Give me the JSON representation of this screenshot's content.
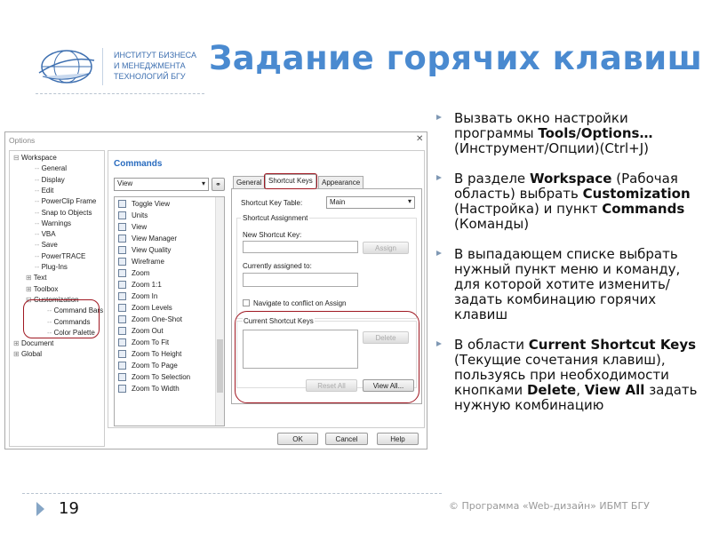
{
  "slide": {
    "title": "Задание горячих клавиш",
    "logo": {
      "lines": [
        "ИНСТИТУТ БИЗНЕСА",
        "И МЕНЕДЖМЕНТА",
        "ТЕХНОЛОГИЙ БГУ"
      ]
    },
    "bullets": [
      {
        "parts": [
          [
            "Вызвать окно настройки программы ",
            false
          ],
          [
            "Tools/Options…",
            true
          ],
          [
            " (Инструмент/Опции)(Ctrl+J)",
            false
          ]
        ]
      },
      {
        "parts": [
          [
            "В разделе ",
            false
          ],
          [
            "Workspace",
            true
          ],
          [
            " (Рабочая область) выбрать ",
            false
          ],
          [
            "Customization",
            true
          ],
          [
            " (Настройка) и пункт ",
            false
          ],
          [
            "Commands",
            true
          ],
          [
            " (Команды)",
            false
          ]
        ]
      },
      {
        "parts": [
          [
            "В  выпадающем списке выбрать нужный пункт меню и команду, для которой хотите изменить/задать комбинацию горячих клавиш",
            false
          ]
        ]
      },
      {
        "parts": [
          [
            "В области ",
            false
          ],
          [
            "Current Shortcut Keys",
            true
          ],
          [
            " (Текущие сочетания клавиш), пользуясь при необходимости кнопками ",
            false
          ],
          [
            "Delete",
            true
          ],
          [
            ", ",
            false
          ],
          [
            "View All",
            true
          ],
          [
            " задать нужную комбинацию",
            false
          ]
        ]
      }
    ],
    "page_number": "19",
    "footer": "© Программа «Web-дизайн» ИБМТ БГУ",
    "accent_color": "#4a8ad0",
    "highlight_color": "#a01822"
  },
  "dialog": {
    "title": "Options",
    "close_icon": "close-icon",
    "tree": [
      {
        "label": "Workspace",
        "level": 0,
        "expander": "minus"
      },
      {
        "label": "General",
        "level": 1
      },
      {
        "label": "Display",
        "level": 1
      },
      {
        "label": "Edit",
        "level": 1
      },
      {
        "label": "PowerClip Frame",
        "level": 1
      },
      {
        "label": "Snap to Objects",
        "level": 1
      },
      {
        "label": "Warnings",
        "level": 1
      },
      {
        "label": "VBA",
        "level": 1
      },
      {
        "label": "Save",
        "level": 1
      },
      {
        "label": "PowerTRACE",
        "level": 1
      },
      {
        "label": "Plug-Ins",
        "level": 1
      },
      {
        "label": "Text",
        "level": 1,
        "expander": "plus"
      },
      {
        "label": "Toolbox",
        "level": 1,
        "expander": "plus"
      },
      {
        "label": "Customization",
        "level": 1,
        "expander": "minus"
      },
      {
        "label": "Command Bars",
        "level": 2
      },
      {
        "label": "Commands",
        "level": 2
      },
      {
        "label": "Color Palette",
        "level": 2
      },
      {
        "label": "Document",
        "level": 0,
        "expander": "plus"
      },
      {
        "label": "Global",
        "level": 0,
        "expander": "plus"
      }
    ],
    "commands_heading": "Commands",
    "category_select": "View",
    "commands": [
      "Toggle View",
      "Units",
      "View",
      "View Manager",
      "View Quality",
      "Wireframe",
      "Zoom",
      "Zoom 1:1",
      "Zoom In",
      "Zoom Levels",
      "Zoom One-Shot",
      "Zoom Out",
      "Zoom To Fit",
      "Zoom To Height",
      "Zoom To Page",
      "Zoom To Selection",
      "Zoom To Width"
    ],
    "tabs": [
      "General",
      "Shortcut Keys",
      "Appearance"
    ],
    "active_tab": "Shortcut Keys",
    "shortcut_table_label": "Shortcut Key Table:",
    "shortcut_table_value": "Main",
    "assignment_group": "Shortcut Assignment",
    "new_key_label": "New Shortcut Key:",
    "new_key_value": "",
    "assign": "Assign",
    "assigned_label": "Currently assigned to:",
    "assigned_value": "",
    "navigate_label": "Navigate to conflict on Assign",
    "navigate_checked": false,
    "current_keys_group": "Current Shortcut Keys",
    "delete": "Delete",
    "reset_all": "Reset All",
    "view_all": "View All...",
    "ok": "OK",
    "cancel": "Cancel",
    "help": "Help"
  }
}
